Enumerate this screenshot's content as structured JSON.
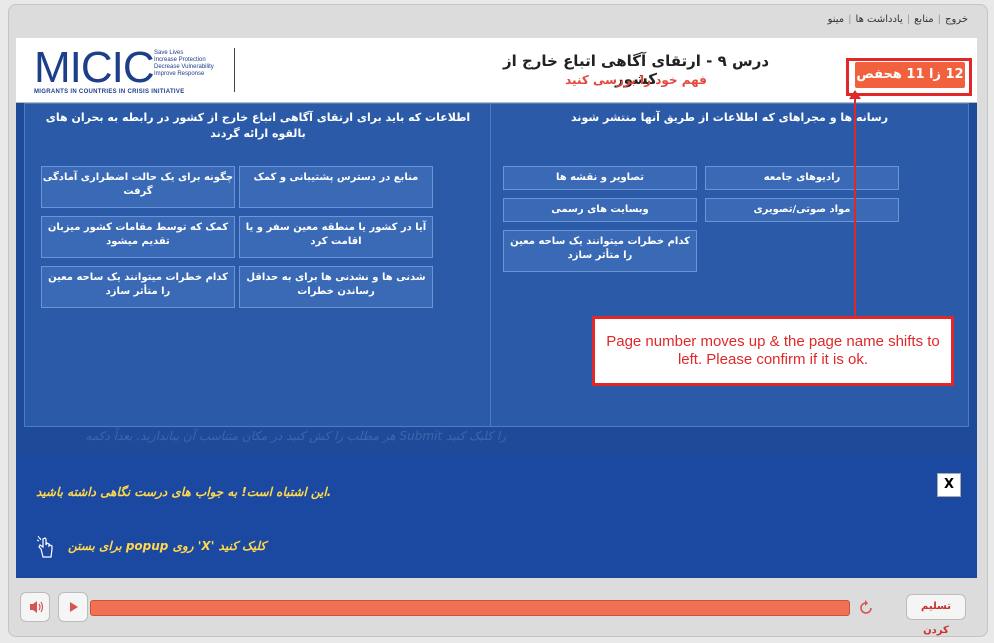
{
  "top_menu": [
    "خروج",
    "منابع",
    "یادداشت ها",
    "مینو"
  ],
  "logo": {
    "main": "MICIC",
    "tagline": [
      "Save Lives",
      "Increase Protection",
      "Decrease Vulnerability",
      "Improve Response"
    ],
    "subtitle": "MIGRANTS IN COUNTRIES IN CRISIS INITIATIVE"
  },
  "lesson": {
    "title": "درس ۹ - ارتقای آگاهی اتباع خارج از کشور",
    "subtitle": "فهم خود را بررسی کنید"
  },
  "page_number": "12 زا 11 هحفص",
  "panels": {
    "left": {
      "title": "اطلاعات که باید برای ارتقای آگاهی اتباع خارج از کشور در رابطه به بحران های بالقوه ارائه گردند",
      "items": [
        "منابع در دسترس پشتیبانی و کمک",
        "چگونه برای یک حالت اضطراری آمادگی گرفت",
        "آیا در کشور یا منطقه معین سفر و یا اقامت کرد",
        "کمک که توسط مقامات کشور میزبان تقدیم میشود",
        "شدنی ها و نشدنی ها برای به حداقل رساندن خطرات",
        "کدام خطرات میتوانند یک ساحه معین را متأثر سازد"
      ]
    },
    "right": {
      "title": "رسانه ها و مجراهای که اطلاعات از طریق آنها منتشر شوند",
      "items": [
        "رادیوهای جامعه",
        "تصاویر و نقشه ها",
        "مواد صوتی/تصویری",
        "وبسایت های رسمی",
        "کدام خطرات میتوانند یک ساحه معین را متأثر سازد"
      ]
    }
  },
  "ghost_instruction": "را کلیک کنید Submit هر مطلب را کش کنید در مکان متناسب آن بیاندازید. بعداً دکمه",
  "feedback": {
    "message": ".این اشتباه است! به جواب های درست نگاهی داشته باشید",
    "close_label": "X",
    "hint": "کلیک کنید 'X' روی popup برای بستن"
  },
  "annotation": "Page number moves up & the page name shifts to left. Please confirm if it is ok.",
  "controls": {
    "submit_label": "تسلیم کردن",
    "progress_percent": 100
  },
  "colors": {
    "main_bg": "#1f4a9a",
    "accent": "#f1613d",
    "annotation_red": "#e0282a",
    "feedback_text": "#ffd84d"
  }
}
